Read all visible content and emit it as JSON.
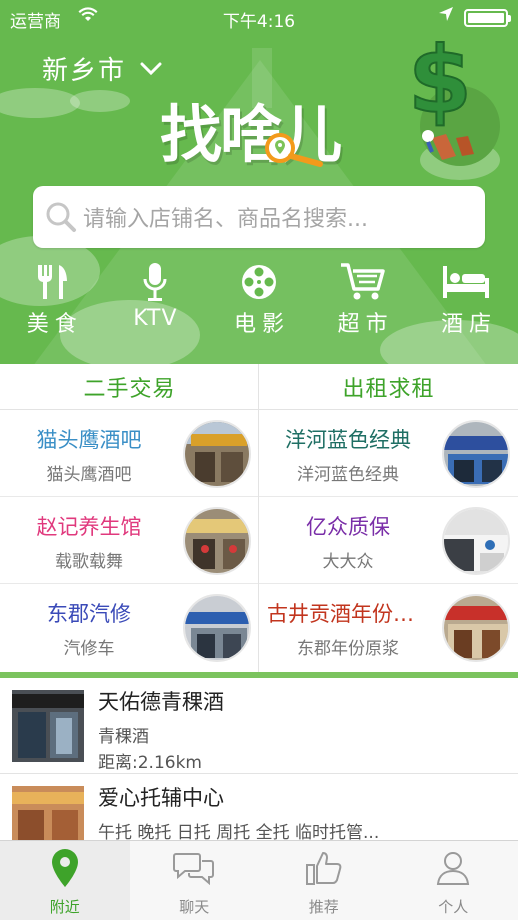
{
  "status_bar": {
    "carrier": "运营商",
    "time": "下午4:16"
  },
  "header": {
    "city": "新乡市",
    "logo": "找啥儿",
    "search_placeholder": "请输入店铺名、商品名搜索..."
  },
  "categories": [
    {
      "label": "美食",
      "icon": "fork-knife-icon"
    },
    {
      "label": "KTV",
      "icon": "microphone-icon"
    },
    {
      "label": "电影",
      "icon": "film-reel-icon"
    },
    {
      "label": "超市",
      "icon": "shopping-cart-icon"
    },
    {
      "label": "酒店",
      "icon": "bed-icon"
    }
  ],
  "sections": {
    "left": {
      "title": "二手交易",
      "items": [
        {
          "title": "猫头鹰酒吧",
          "subtitle": "猫头鹰酒吧",
          "color": "#3a8fc6"
        },
        {
          "title": "赵记养生馆",
          "subtitle": "载歌载舞",
          "color": "#e0397d"
        },
        {
          "title": "东郡汽修",
          "subtitle": "汽修车",
          "color": "#3a4ab8"
        }
      ]
    },
    "right": {
      "title": "出租求租",
      "items": [
        {
          "title": "洋河蓝色经典",
          "subtitle": "洋河蓝色经典",
          "color": "#1f6f64"
        },
        {
          "title": "亿众质保",
          "subtitle": "大大众",
          "color": "#7a2ea8"
        },
        {
          "title": "古井贡酒年份原浆",
          "subtitle": "东郡年份原浆",
          "color": "#c2351e"
        }
      ]
    }
  },
  "nearby": [
    {
      "name": "天佑德青稞酒",
      "desc": "青稞酒",
      "distance": "距离:2.16km"
    },
    {
      "name": "爱心托辅中心",
      "desc": "午托 晚托 日托 周托 全托 临时托管...",
      "distance": ""
    }
  ],
  "tabs": [
    {
      "label": "附近",
      "icon": "location-pin-icon",
      "active": true
    },
    {
      "label": "聊天",
      "icon": "chat-bubbles-icon",
      "active": false
    },
    {
      "label": "推荐",
      "icon": "thumbs-up-icon",
      "active": false
    },
    {
      "label": "个人",
      "icon": "person-icon",
      "active": false
    }
  ],
  "colors": {
    "brand_green": "#66b94e",
    "accent_green": "#3ea32a",
    "logo_orange": "#f39a1b"
  }
}
